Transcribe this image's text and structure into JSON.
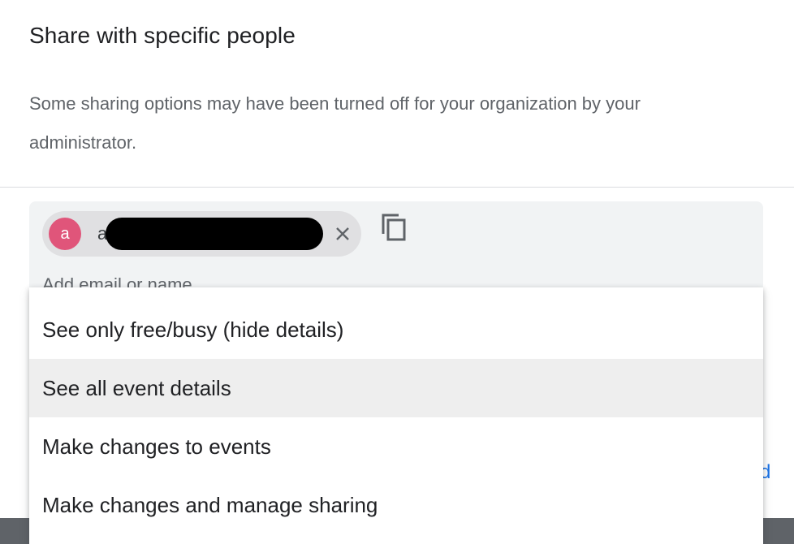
{
  "dialog": {
    "title": "Share with specific people",
    "description": "Some sharing options may have been turned off for your organization by your administrator."
  },
  "recipients": [
    {
      "avatar_letter": "a",
      "label": "a",
      "redacted": true
    }
  ],
  "input": {
    "placeholder": "Add email or name"
  },
  "background_link": {
    "visible_fragment": "d"
  },
  "permission_menu": {
    "selected_index": 1,
    "items": [
      {
        "label": "See only free/busy (hide details)"
      },
      {
        "label": "See all event details"
      },
      {
        "label": "Make changes to events"
      },
      {
        "label": "Make changes and manage sharing"
      }
    ]
  },
  "icons": {
    "remove": "close-icon",
    "copy": "copy-icon"
  },
  "colors": {
    "avatar": "#e0557a",
    "link": "#1a73e8",
    "selected_item": "#eeeeee",
    "chip_area": "#f1f3f4"
  }
}
